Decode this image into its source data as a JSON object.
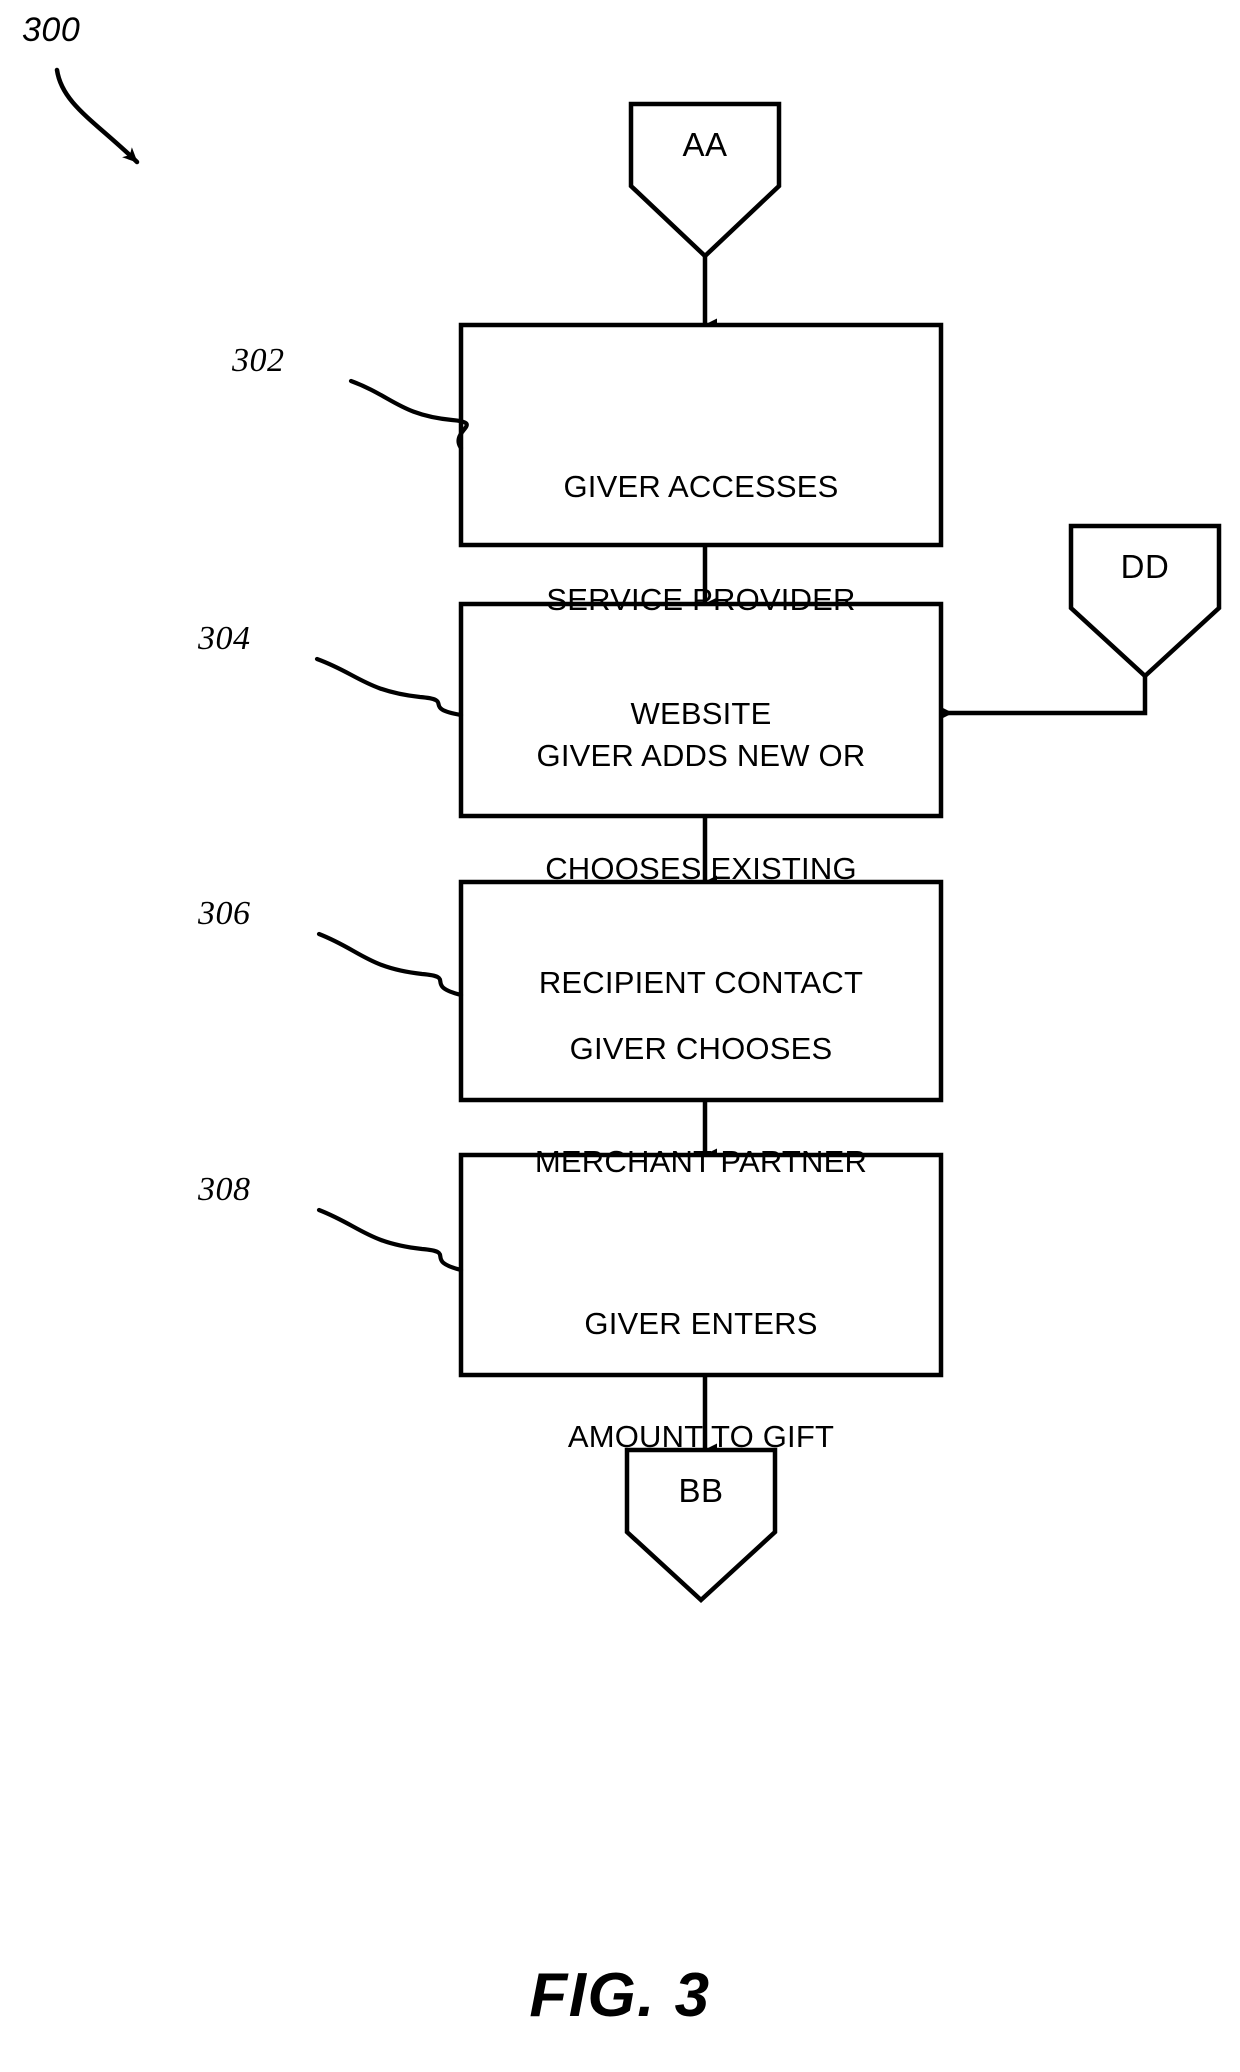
{
  "figure": {
    "caption": "FIG. 3",
    "figure_number": "300",
    "stroke_color": "#000000",
    "background_color": "#ffffff"
  },
  "connectors": [
    {
      "id": "AA",
      "label": "AA",
      "role": "entry-connector"
    },
    {
      "id": "DD",
      "label": "DD",
      "role": "entry-connector"
    },
    {
      "id": "BB",
      "label": "BB",
      "role": "exit-connector"
    }
  ],
  "steps": [
    {
      "ref": "302",
      "lines": [
        "GIVER ACCESSES",
        "SERVICE PROVIDER",
        "WEBSITE"
      ],
      "text": "GIVER ACCESSES SERVICE PROVIDER WEBSITE"
    },
    {
      "ref": "304",
      "lines": [
        "GIVER ADDS NEW OR",
        "CHOOSES EXISTING",
        "RECIPIENT CONTACT"
      ],
      "text": "GIVER ADDS NEW OR CHOOSES EXISTING RECIPIENT CONTACT"
    },
    {
      "ref": "306",
      "lines": [
        "GIVER CHOOSES",
        "MERCHANT PARTNER"
      ],
      "text": "GIVER CHOOSES MERCHANT PARTNER"
    },
    {
      "ref": "308",
      "lines": [
        "GIVER ENTERS",
        "AMOUNT TO GIFT"
      ],
      "text": "GIVER ENTERS AMOUNT TO GIFT"
    }
  ],
  "flow": {
    "edges": [
      {
        "from": "AA",
        "to": "302"
      },
      {
        "from": "302",
        "to": "304"
      },
      {
        "from": "DD",
        "to": "304"
      },
      {
        "from": "304",
        "to": "306"
      },
      {
        "from": "306",
        "to": "308"
      },
      {
        "from": "308",
        "to": "BB"
      }
    ]
  }
}
